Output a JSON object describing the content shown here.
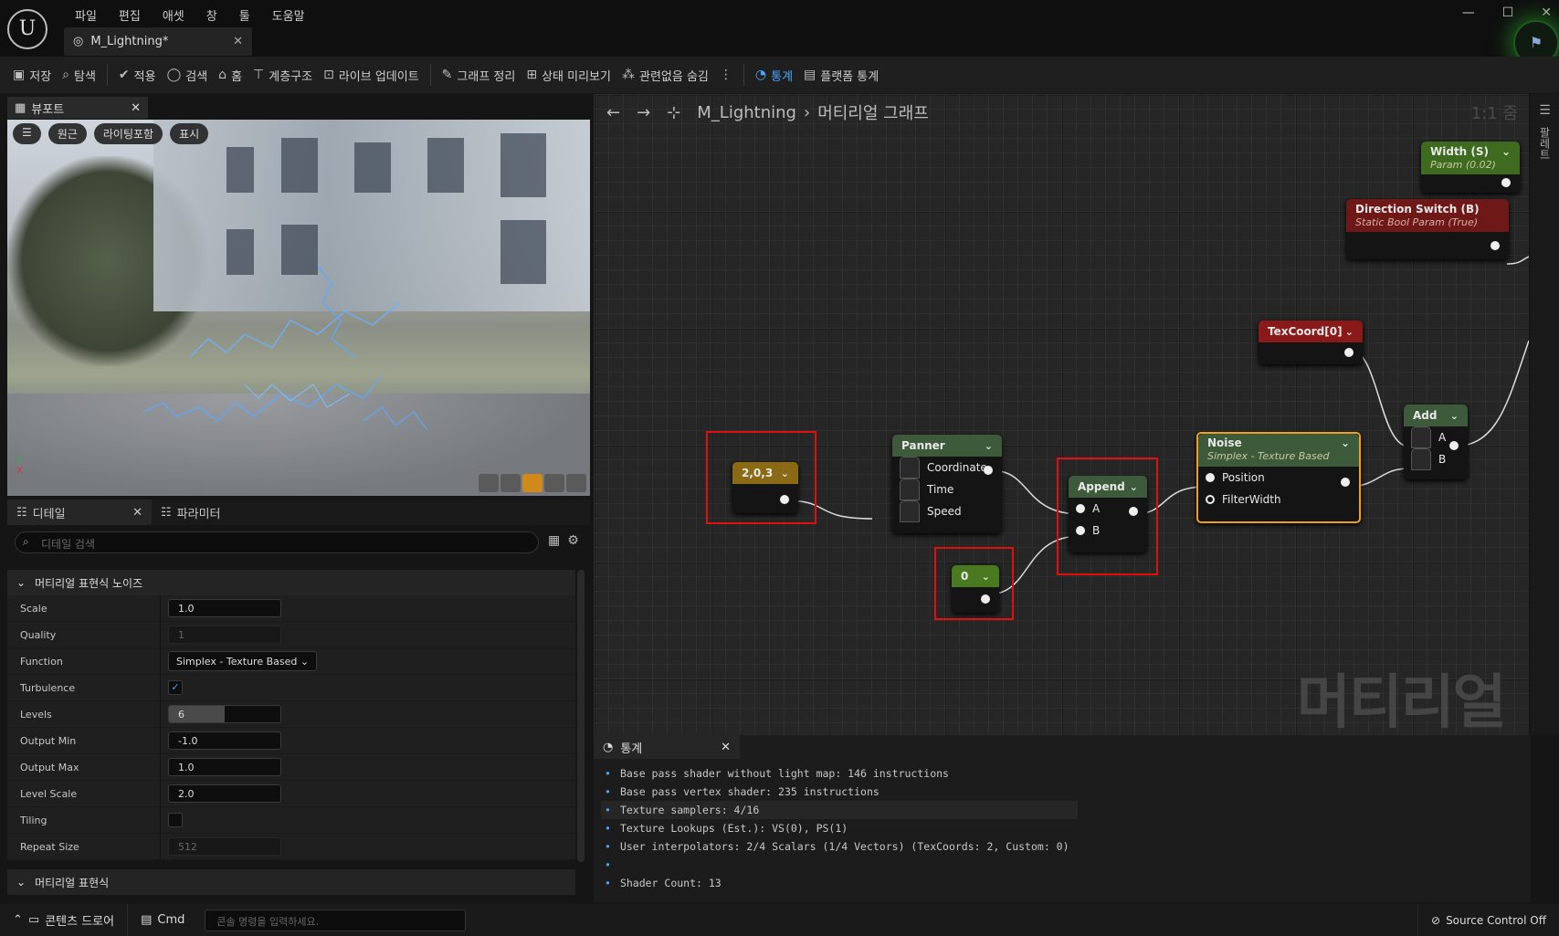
{
  "app": {
    "menu": [
      "파일",
      "편집",
      "애셋",
      "창",
      "툴",
      "도움말"
    ],
    "doc_tab": "M_Lightning*"
  },
  "toolbar": [
    {
      "icon": "save-icon",
      "label": "저장"
    },
    {
      "icon": "browse-icon",
      "label": "탐색"
    },
    {
      "icon": "apply-icon",
      "label": "적용"
    },
    {
      "icon": "search-icon",
      "label": "검색"
    },
    {
      "icon": "home-icon",
      "label": "홈"
    },
    {
      "icon": "hierarchy-icon",
      "label": "계층구조"
    },
    {
      "icon": "live-update-icon",
      "label": "라이브 업데이트"
    },
    {
      "icon": "clean-graph-icon",
      "label": "그래프 정리"
    },
    {
      "icon": "preview-state-icon",
      "label": "상태 미리보기"
    },
    {
      "icon": "hide-unrelated-icon",
      "label": "관련없음 숨김"
    },
    {
      "icon": "stats-icon",
      "label": "통계",
      "active": true
    },
    {
      "icon": "platform-stats-icon",
      "label": "플랫폼 통계"
    }
  ],
  "viewport": {
    "tab": "뷰포트",
    "buttons": [
      "원근",
      "라이팅포함",
      "표시"
    ]
  },
  "details": {
    "tabs": [
      "디테일",
      "파라미터"
    ],
    "search_placeholder": "디테일 검색",
    "section1": "머티리얼 표현식 노이즈",
    "section2": "머티리얼 표현식",
    "props": [
      {
        "name": "Scale",
        "value": "1.0",
        "type": "input"
      },
      {
        "name": "Quality",
        "value": "1",
        "type": "disabled"
      },
      {
        "name": "Function",
        "value": "Simplex - Texture Based",
        "type": "dropdown"
      },
      {
        "name": "Turbulence",
        "value": "✓",
        "type": "checkbox"
      },
      {
        "name": "Levels",
        "value": "6",
        "type": "slider",
        "fill": 0.5
      },
      {
        "name": "Output Min",
        "value": "-1.0",
        "type": "input"
      },
      {
        "name": "Output Max",
        "value": "1.0",
        "type": "input"
      },
      {
        "name": "Level Scale",
        "value": "2.0",
        "type": "input"
      },
      {
        "name": "Tiling",
        "value": "",
        "type": "checkbox"
      },
      {
        "name": "Repeat Size",
        "value": "512",
        "type": "disabled"
      }
    ]
  },
  "graph": {
    "breadcrumb_asset": "M_Lightning",
    "breadcrumb_page": "머티리얼 그래프",
    "zoom": "1:1 줌",
    "watermark": "머티리얼",
    "rail_label": "팔레트",
    "nodes": {
      "width": {
        "title": "Width (S)",
        "sub": "Param (0.02)"
      },
      "direction": {
        "title": "Direction Switch (B)",
        "sub": "Static Bool Param (True)"
      },
      "texcoord": {
        "title": "TexCoord[0]"
      },
      "add": {
        "title": "Add",
        "pins": [
          "A",
          "B"
        ]
      },
      "const3": {
        "title": "2,0,3"
      },
      "panner": {
        "title": "Panner",
        "pins": [
          "Coordinate",
          "Time",
          "Speed"
        ]
      },
      "append": {
        "title": "Append",
        "pins": [
          "A",
          "B"
        ]
      },
      "noise": {
        "title": "Noise",
        "sub": "Simplex - Texture Based",
        "pins": [
          "Position",
          "FilterWidth"
        ]
      },
      "zero": {
        "title": "0"
      }
    }
  },
  "stats": {
    "tab": "통계",
    "lines": [
      "Base pass shader without light map: 146 instructions",
      "Base pass vertex shader: 235 instructions",
      "Texture samplers: 4/16",
      "Texture Lookups (Est.): VS(0), PS(1)",
      "User interpolators: 2/4 Scalars (1/4 Vectors) (TexCoords: 2, Custom: 0)",
      "",
      "Shader Count: 13"
    ]
  },
  "statusbar": {
    "content_drawer": "콘텐츠 드로어",
    "cmd": "Cmd",
    "cmd_placeholder": "콘솔 명령을 입력하세요.",
    "source_control": "Source Control Off"
  }
}
